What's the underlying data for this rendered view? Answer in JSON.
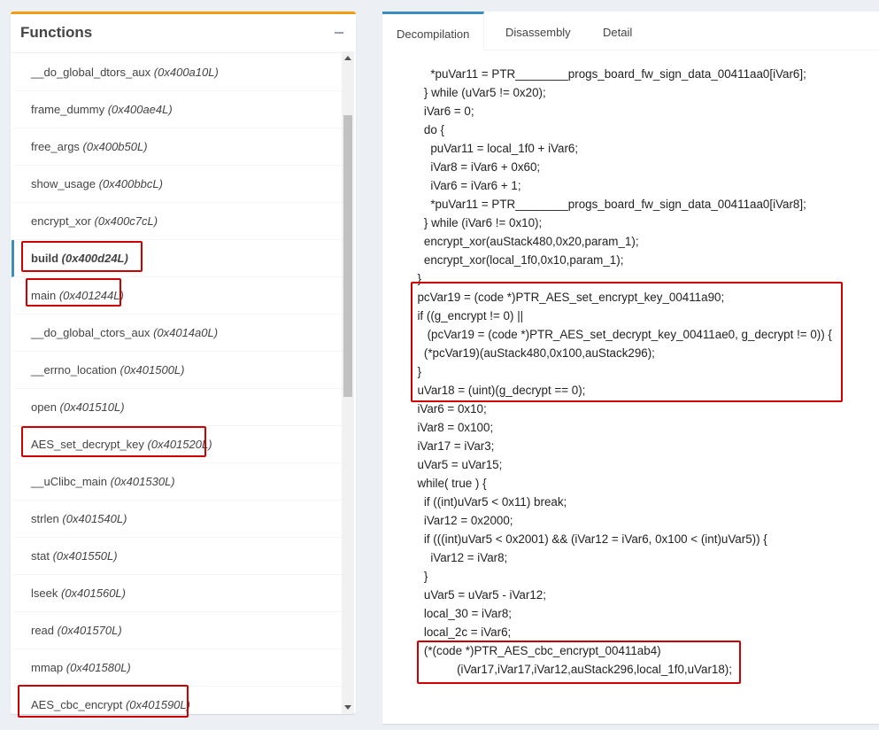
{
  "functions_panel": {
    "title": "Functions",
    "items": [
      {
        "name": "__do_global_dtors_aux",
        "addr": "(0x400a10L)"
      },
      {
        "name": "frame_dummy",
        "addr": "(0x400ae4L)"
      },
      {
        "name": "free_args",
        "addr": "(0x400b50L)"
      },
      {
        "name": "show_usage",
        "addr": "(0x400bbcL)"
      },
      {
        "name": "encrypt_xor",
        "addr": "(0x400c7cL)"
      },
      {
        "name": "build",
        "addr": "(0x400d24L)"
      },
      {
        "name": "main",
        "addr": "(0x401244L)"
      },
      {
        "name": "__do_global_ctors_aux",
        "addr": "(0x4014a0L)"
      },
      {
        "name": "__errno_location",
        "addr": "(0x401500L)"
      },
      {
        "name": "open",
        "addr": "(0x401510L)"
      },
      {
        "name": "AES_set_decrypt_key",
        "addr": "(0x401520L)"
      },
      {
        "name": "__uClibc_main",
        "addr": "(0x401530L)"
      },
      {
        "name": "strlen",
        "addr": "(0x401540L)"
      },
      {
        "name": "stat",
        "addr": "(0x401550L)"
      },
      {
        "name": "lseek",
        "addr": "(0x401560L)"
      },
      {
        "name": "read",
        "addr": "(0x401570L)"
      },
      {
        "name": "mmap",
        "addr": "(0x401580L)"
      },
      {
        "name": "AES_cbc_encrypt",
        "addr": "(0x401590L)"
      }
    ]
  },
  "tabs": [
    "Decompilation",
    "Disassembly",
    "Detail"
  ],
  "code_lines": [
    "      *puVar11 = PTR________progs_board_fw_sign_data_00411aa0[iVar6];",
    "    } while (uVar5 != 0x20);",
    "    iVar6 = 0;",
    "    do {",
    "      puVar11 = local_1f0 + iVar6;",
    "      iVar8 = iVar6 + 0x60;",
    "      iVar6 = iVar6 + 1;",
    "      *puVar11 = PTR________progs_board_fw_sign_data_00411aa0[iVar8];",
    "    } while (iVar6 != 0x10);",
    "    encrypt_xor(auStack480,0x20,param_1);",
    "    encrypt_xor(local_1f0,0x10,param_1);",
    "  }",
    "  pcVar19 = (code *)PTR_AES_set_encrypt_key_00411a90;",
    "  if ((g_encrypt != 0) ||",
    "     (pcVar19 = (code *)PTR_AES_set_decrypt_key_00411ae0, g_decrypt != 0)) {",
    "    (*pcVar19)(auStack480,0x100,auStack296);",
    "  }",
    "  uVar18 = (uint)(g_decrypt == 0);",
    "  iVar6 = 0x10;",
    "  iVar8 = 0x100;",
    "  iVar17 = iVar3;",
    "  uVar5 = uVar15;",
    "  while( true ) {",
    "    if ((int)uVar5 < 0x11) break;",
    "    iVar12 = 0x2000;",
    "    if (((int)uVar5 < 0x2001) && (iVar12 = iVar6, 0x100 < (int)uVar5)) {",
    "      iVar12 = iVar8;",
    "    }",
    "    uVar5 = uVar5 - iVar12;",
    "    local_30 = iVar8;",
    "    local_2c = iVar6;",
    "    (*(code *)PTR_AES_cbc_encrypt_00411ab4)",
    "              (iVar17,iVar17,iVar12,auStack296,local_1f0,uVar18);"
  ],
  "colors": {
    "header_accent": "#f39c12",
    "tab_accent": "#3c8dbc",
    "highlight_box": "#cc0000"
  }
}
